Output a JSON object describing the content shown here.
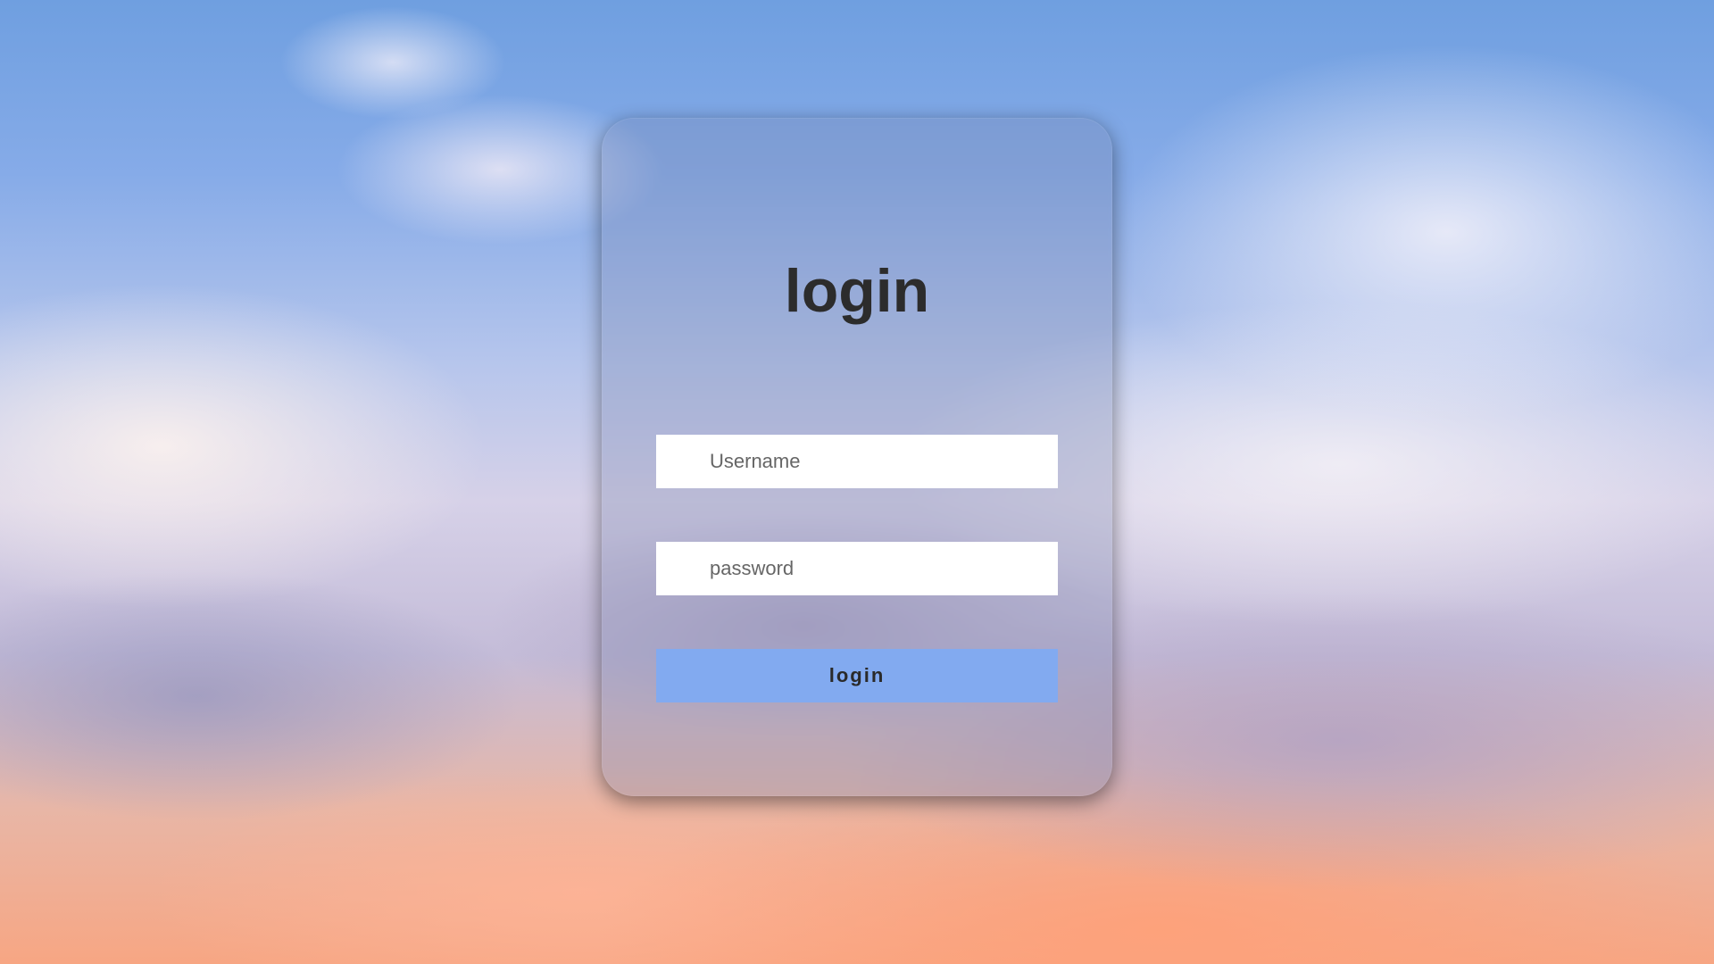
{
  "login_form": {
    "title": "login",
    "username_placeholder": "Username",
    "password_placeholder": "password",
    "submit_label": "login"
  },
  "colors": {
    "button_background": "#82aaf0",
    "input_background": "#ffffff",
    "title_color": "#2c2c2c"
  }
}
